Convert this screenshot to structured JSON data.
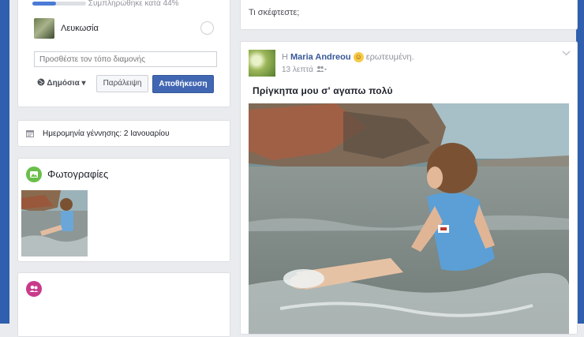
{
  "intro": {
    "progress_text": "Συμπληρώθηκε κατά 44%",
    "progress_value": 0.44,
    "place_name": "Λευκωσία",
    "residence_placeholder": "Προσθέστε τον τόπο διαμονής",
    "privacy_label": "Δημόσια",
    "skip_label": "Παράλειψη",
    "save_label": "Αποθήκευση"
  },
  "birthday": {
    "text": "Ημερομηνία γέννησης: 2 Ιανουαρίου"
  },
  "photos": {
    "title": "Φωτογραφίες"
  },
  "composer": {
    "placeholder": "Τι σκέφτεστε;"
  },
  "post": {
    "prefix": "Η",
    "author": "Maria Andreou",
    "feeling": "ερωτευμένη.",
    "time": "13 λεπτά",
    "text": "Πρίγκηπα μου σ' αγαπω  πολύ"
  },
  "colors": {
    "frame": "#2f5fae",
    "background": "#e9ebee",
    "link": "#385898",
    "primary_button": "#4267b2",
    "photos_icon": "#69bf4a",
    "friends_icon": "#c83a8a"
  },
  "icons": {
    "privacy": "globe-icon",
    "privacy_caret": "caret-down-icon",
    "birthday": "calendar-icon",
    "photos": "photos-icon",
    "friends": "friends-icon",
    "audience": "friends-audience-icon",
    "post_menu": "chevron-down-icon",
    "feeling": "smiley-icon"
  }
}
